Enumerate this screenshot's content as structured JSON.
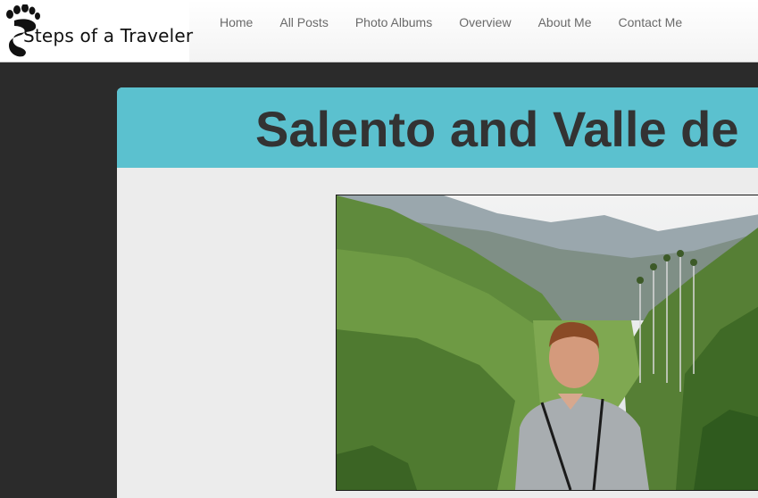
{
  "site": {
    "logo_text": "Steps of a Traveler"
  },
  "nav": {
    "items": [
      {
        "label": "Home"
      },
      {
        "label": "All Posts"
      },
      {
        "label": "Photo Albums"
      },
      {
        "label": "Overview"
      },
      {
        "label": "About Me"
      },
      {
        "label": "Contact Me"
      }
    ]
  },
  "post": {
    "title": "Salento and Valle de"
  },
  "colors": {
    "header_accent": "#5bc1cf",
    "page_background": "#2b2b2b",
    "card_background": "#ececec",
    "title_text": "#333333"
  }
}
